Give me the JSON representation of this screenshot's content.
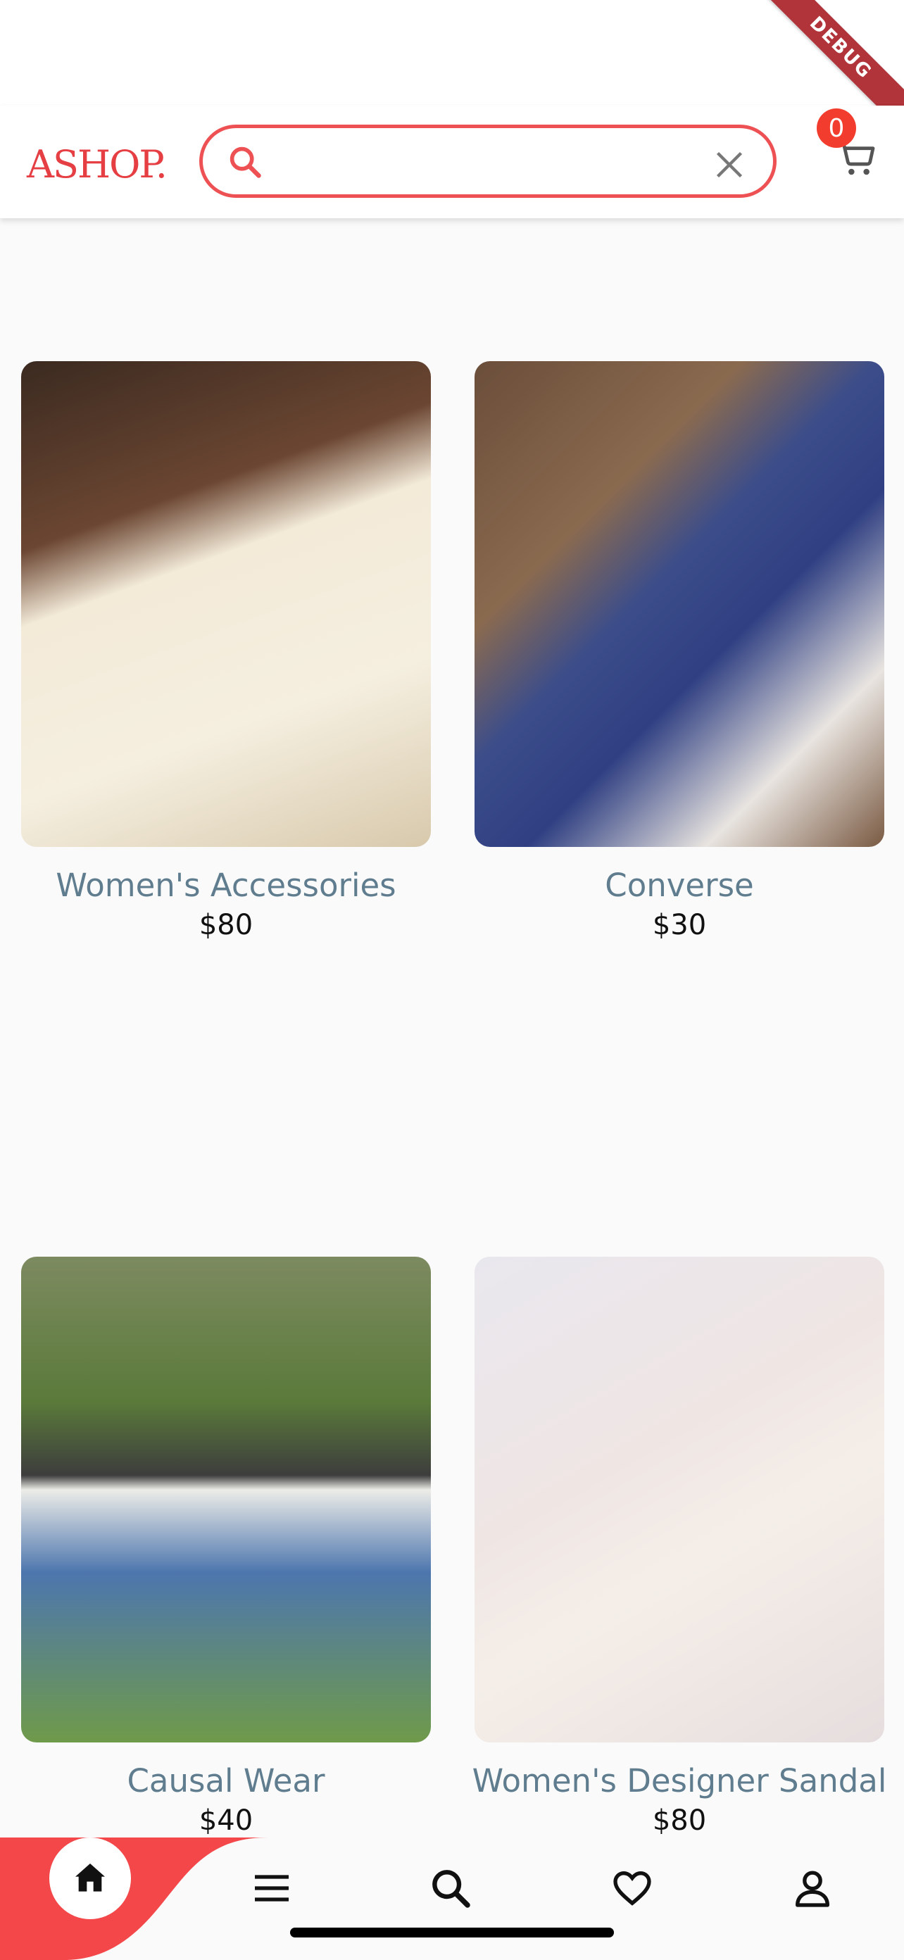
{
  "debug_banner": "DEBUG",
  "app_bar": {
    "logo": "ASHOP.",
    "search": {
      "value": "",
      "placeholder": ""
    },
    "cart_count": "0"
  },
  "products": [
    {
      "name": "Women's Accessories",
      "price": "$80"
    },
    {
      "name": "Converse",
      "price": "$30"
    },
    {
      "name": "Causal Wear",
      "price": "$40"
    },
    {
      "name": "Women's Designer Sandal",
      "price": "$80"
    }
  ],
  "bottom_nav": {
    "items": [
      "home-icon",
      "menu-icon",
      "search-icon",
      "heart-icon",
      "profile-icon"
    ],
    "active": "home",
    "accent": "#f4474a"
  },
  "colors": {
    "brand": "#e53e43",
    "search_border": "#ee5154",
    "badge": "#f23d2e",
    "title": "#5f7d8e"
  }
}
